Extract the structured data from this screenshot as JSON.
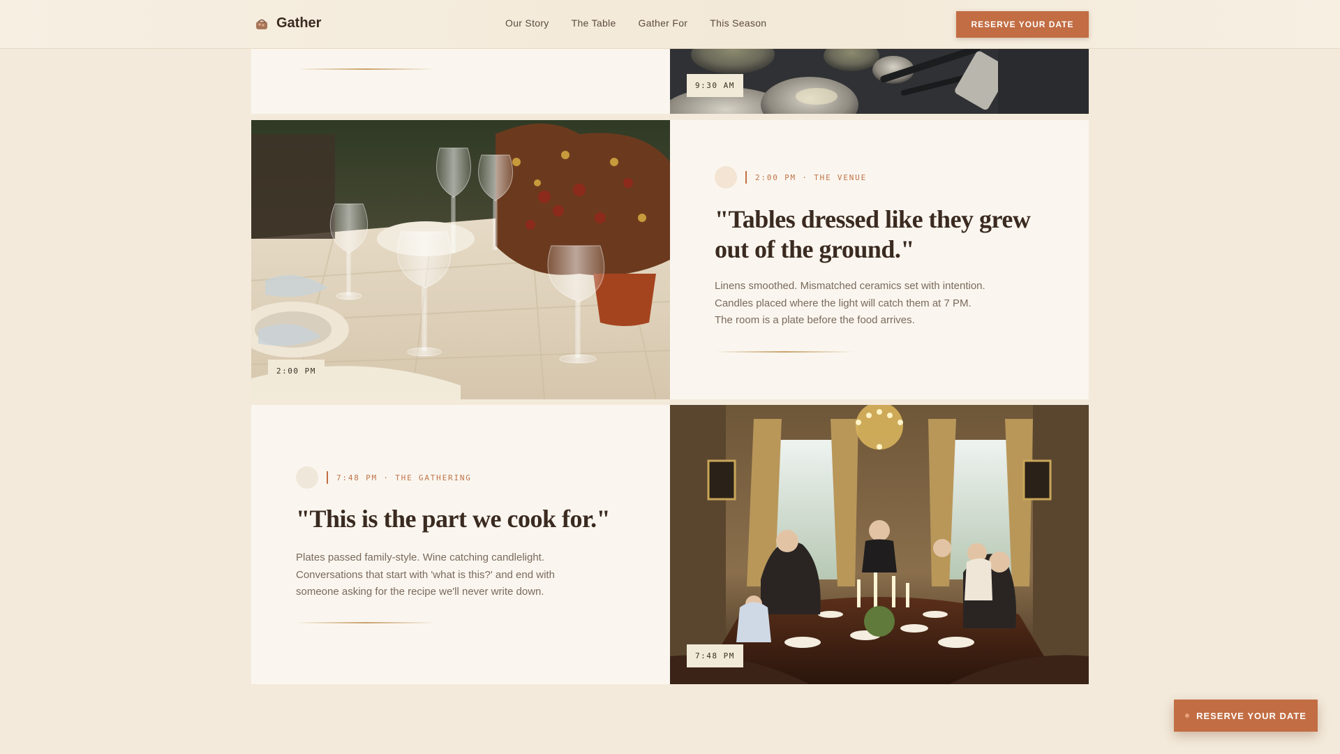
{
  "header": {
    "brand_name": "Gather",
    "brand_icon": "basket-icon",
    "nav": [
      "Our Story",
      "The Table",
      "Gather For",
      "This Season"
    ],
    "cta_label": "RESERVE YOUR DATE"
  },
  "timeline": {
    "morning": {
      "time_tag": "9:30 AM"
    },
    "venue": {
      "time_tag": "2:00 PM",
      "meta": "2:00 PM · THE VENUE",
      "quote": "\"Tables dressed like they grew out of the ground.\"",
      "body": "Linens smoothed. Mismatched ceramics set with intention. Candles placed where the light will catch them at 7 PM. The room is a plate before the food arrives."
    },
    "gathering": {
      "time_tag": "7:48 PM",
      "meta": "7:48 PM · THE GATHERING",
      "quote": "\"This is the part we cook for.\"",
      "body": "Plates passed family-style. Wine catching candlelight. Conversations that start with 'what is this?' and end with someone asking for the recipe we'll never write down."
    }
  },
  "floating_cta": {
    "label": "RESERVE YOUR DATE"
  },
  "colors": {
    "accent": "#c26d43",
    "background": "#f3eadb",
    "card": "#faf6ef"
  }
}
